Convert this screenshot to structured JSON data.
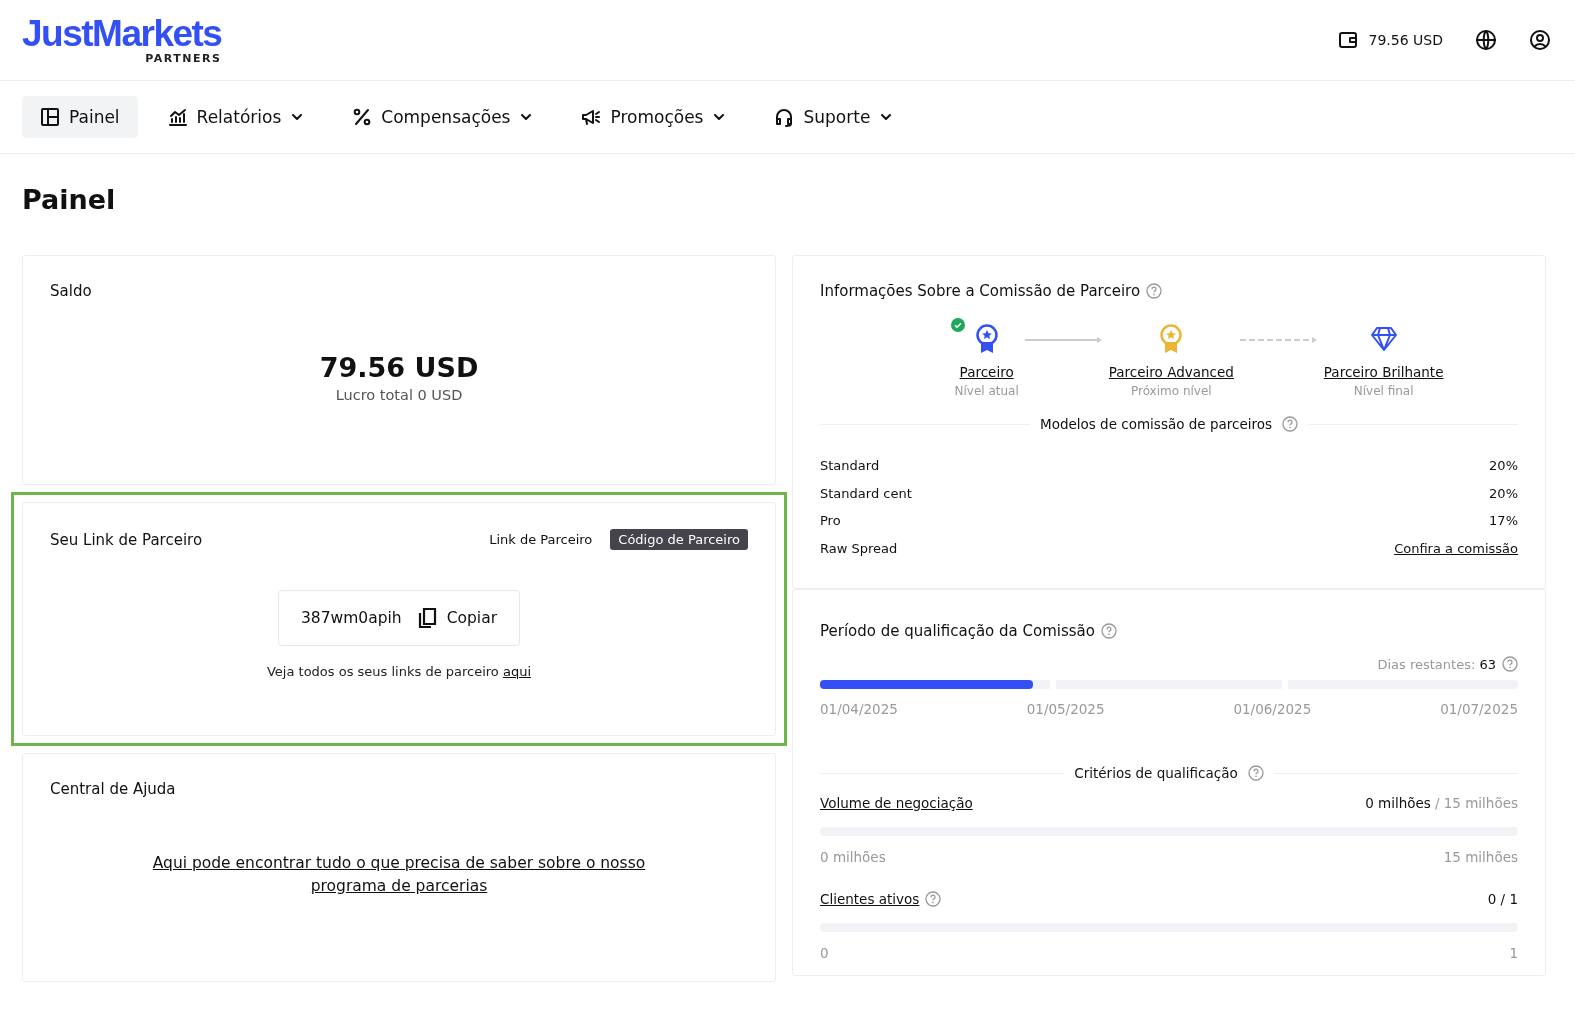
{
  "header": {
    "logo": "JustMarkets",
    "logo_sub": "PARTNERS",
    "balance": "79.56 USD"
  },
  "nav": [
    {
      "label": "Painel",
      "selected": true,
      "has_menu": false,
      "kind": "dashboard"
    },
    {
      "label": "Relatórios",
      "selected": false,
      "has_menu": true,
      "kind": "chart"
    },
    {
      "label": "Compensações",
      "selected": false,
      "has_menu": true,
      "kind": "percent"
    },
    {
      "label": "Promoções",
      "selected": false,
      "has_menu": true,
      "kind": "megaphone"
    },
    {
      "label": "Suporte",
      "selected": false,
      "has_menu": true,
      "kind": "headset"
    }
  ],
  "page_title": "Painel",
  "balance_card": {
    "title": "Saldo",
    "amount": "79.56 USD",
    "subtitle": "Lucro total 0 USD"
  },
  "partner_link_card": {
    "title": "Seu Link de Parceiro",
    "highlighted": true,
    "tabs": [
      {
        "label": "Link de Parceiro",
        "selected": false
      },
      {
        "label": "Código de Parceiro",
        "selected": true
      }
    ],
    "code": "387wm0apih",
    "copy_label": "Copiar",
    "note": "Veja todos os seus links de parceiro",
    "note_link": "aqui"
  },
  "help_card": {
    "title": "Central de Ajuda",
    "link": "Aqui pode encontrar tudo o que precisa de saber sobre o nosso programa de parcerias"
  },
  "commission_card": {
    "title": "Informações Sobre a Comissão de Parceiro",
    "levels": [
      {
        "name": "Parceiro",
        "caption": "Nível atual",
        "kind": "ribbon",
        "color": "#3350f5",
        "achieved": true
      },
      {
        "name": "Parceiro Advanced",
        "caption": "Próximo nível",
        "kind": "ribbon",
        "color": "#e8b536",
        "achieved": false
      },
      {
        "name": "Parceiro Brilhante",
        "caption": "Nível final",
        "kind": "diamond",
        "color": "#3350f5",
        "achieved": false
      }
    ],
    "models_title": "Modelos de comissão de parceiros",
    "models": [
      {
        "name": "Standard",
        "value": "20%",
        "kind": "text"
      },
      {
        "name": "Standard cent",
        "value": "20%",
        "kind": "text"
      },
      {
        "name": "Pro",
        "value": "17%",
        "kind": "text"
      },
      {
        "name": "Raw Spread",
        "value": "Confira a comissão",
        "kind": "link"
      }
    ]
  },
  "period_card": {
    "title": "Período de qualificação da Comissão",
    "days_label": "Dias restantes:",
    "days": "63",
    "level": 0.305,
    "dates": [
      "01/04/2025",
      "01/05/2025",
      "01/06/2025",
      "01/07/2025"
    ],
    "criteria_title": "Critérios de qualificação",
    "criteria": [
      {
        "name": "Volume de negociação",
        "help": false,
        "current": "0 milhões",
        "target": "/ 15 milhões",
        "level": 0,
        "min": "0 milhões",
        "max": "15 milhões"
      },
      {
        "name": "Clientes ativos",
        "help": true,
        "current": "0 / 1",
        "level": 0,
        "min": "0",
        "max": "1"
      }
    ]
  }
}
